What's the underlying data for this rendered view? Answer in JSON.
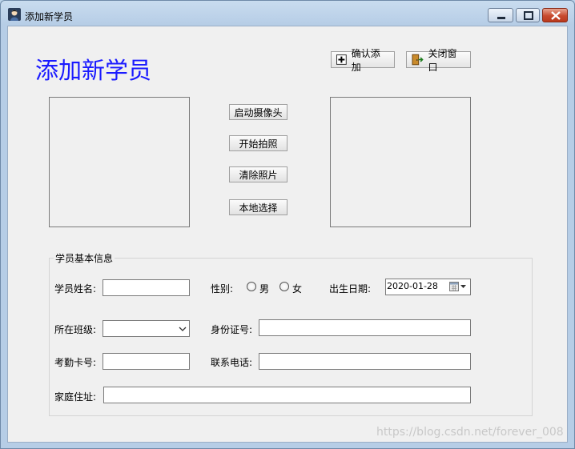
{
  "window": {
    "title": "添加新学员"
  },
  "heading": "添加新学员",
  "toolbar": {
    "confirm_label": "确认添加",
    "close_label": "关闭窗口"
  },
  "camera": {
    "start_label": "启动摄像头",
    "capture_label": "开始拍照",
    "clear_label": "清除照片",
    "local_label": "本地选择"
  },
  "info": {
    "group_title": "学员基本信息",
    "name_label": "学员姓名:",
    "gender_label": "性别:",
    "male_label": "男",
    "female_label": "女",
    "birth_label": "出生日期:",
    "birth_value": "2020-01-28",
    "class_label": "所在班级:",
    "idcard_label": "身份证号:",
    "card_label": "考勤卡号:",
    "phone_label": "联系电话:",
    "address_label": "家庭住址:"
  },
  "watermark": "https://blog.csdn.net/forever_008"
}
